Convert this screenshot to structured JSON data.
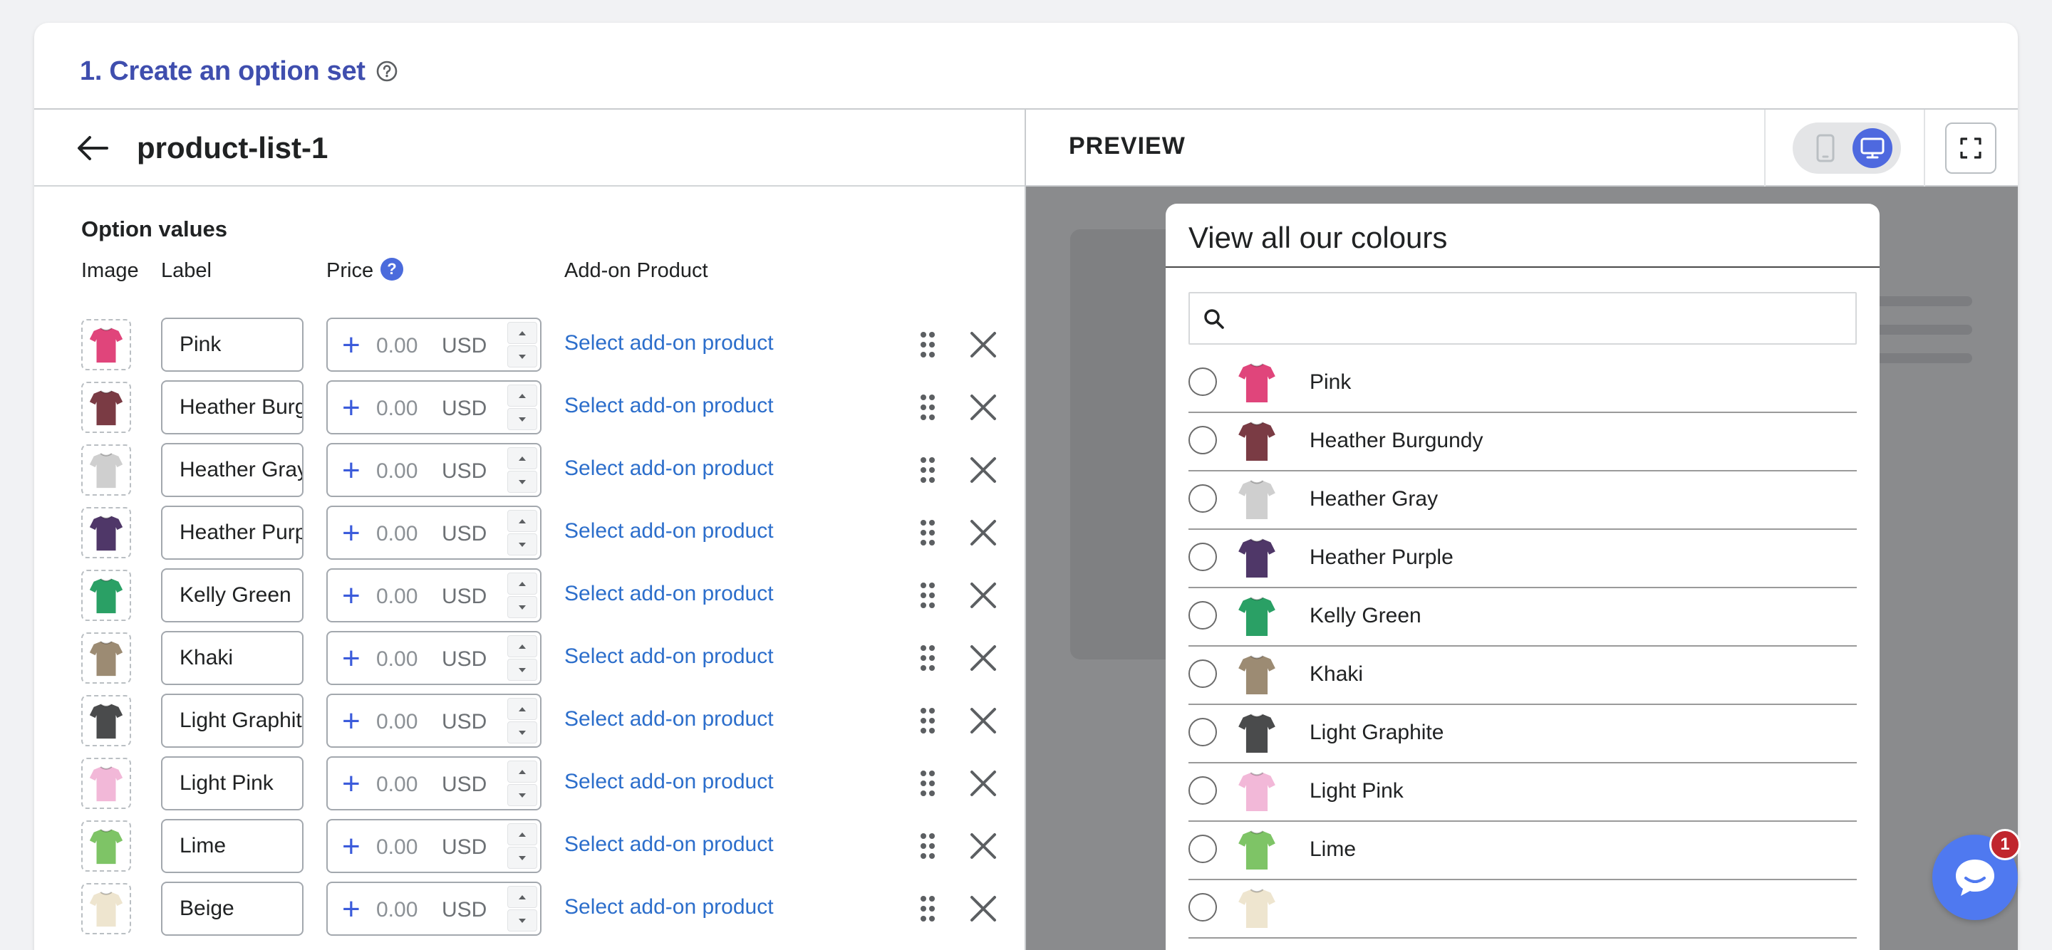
{
  "card": {
    "title": "1. Create an option set"
  },
  "editor": {
    "set_name": "product-list-1",
    "section_title": "Option values",
    "columns": {
      "image": "Image",
      "label": "Label",
      "price": "Price",
      "addon": "Add-on Product"
    },
    "price_help": "?",
    "rows": [
      {
        "label": "Pink",
        "price": "0.00",
        "currency": "USD",
        "addon": "Select add-on product",
        "color": "#e0457b"
      },
      {
        "label": "Heather Burgundy",
        "price": "0.00",
        "currency": "USD",
        "addon": "Select add-on product",
        "color": "#7a3b44"
      },
      {
        "label": "Heather Gray",
        "price": "0.00",
        "currency": "USD",
        "addon": "Select add-on product",
        "color": "#cfcfcf"
      },
      {
        "label": "Heather Purple",
        "price": "0.00",
        "currency": "USD",
        "addon": "Select add-on product",
        "color": "#4f3768"
      },
      {
        "label": "Kelly Green",
        "price": "0.00",
        "currency": "USD",
        "addon": "Select add-on product",
        "color": "#2aa065"
      },
      {
        "label": "Khaki",
        "price": "0.00",
        "currency": "USD",
        "addon": "Select add-on product",
        "color": "#9c8b73"
      },
      {
        "label": "Light Graphite",
        "price": "0.00",
        "currency": "USD",
        "addon": "Select add-on product",
        "color": "#4a4b4c"
      },
      {
        "label": "Light Pink",
        "price": "0.00",
        "currency": "USD",
        "addon": "Select add-on product",
        "color": "#f2b8d8"
      },
      {
        "label": "Lime",
        "price": "0.00",
        "currency": "USD",
        "addon": "Select add-on product",
        "color": "#7ec466"
      },
      {
        "label": "Beige",
        "price": "0.00",
        "currency": "USD",
        "addon": "Select add-on product",
        "color": "#eee5cf"
      }
    ]
  },
  "preview": {
    "title": "PREVIEW",
    "modal_title": "View all our colours",
    "search_placeholder": "",
    "options": [
      {
        "name": "Pink",
        "color": "#e0457b"
      },
      {
        "name": "Heather Burgundy",
        "color": "#7a3b44"
      },
      {
        "name": "Heather Gray",
        "color": "#cfcfcf"
      },
      {
        "name": "Heather Purple",
        "color": "#4f3768"
      },
      {
        "name": "Kelly Green",
        "color": "#2aa065"
      },
      {
        "name": "Khaki",
        "color": "#9c8b73"
      },
      {
        "name": "Light Graphite",
        "color": "#4a4b4c"
      },
      {
        "name": "Light Pink",
        "color": "#f2b8d8"
      },
      {
        "name": "Lime",
        "color": "#7ec466"
      },
      {
        "name": "",
        "color": "#eee5cf"
      }
    ]
  },
  "chat": {
    "badge": "1"
  },
  "icons": {
    "help": "help-circle-icon",
    "back": "arrow-left-icon",
    "drag": "drag-handle-icon",
    "remove": "close-icon",
    "mobile": "mobile-icon",
    "desktop": "desktop-icon",
    "fullscreen": "fullscreen-icon",
    "search": "search-icon",
    "chat": "chat-icon"
  },
  "colors": {
    "accent": "#3f4eae",
    "link": "#2c6ecb",
    "toggle_active": "#4e69df",
    "chat": "#4f79f0",
    "badge": "#c0262d"
  }
}
